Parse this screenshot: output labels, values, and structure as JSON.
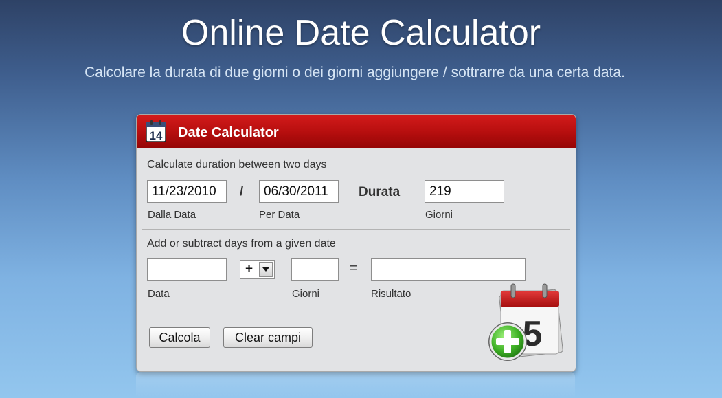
{
  "page": {
    "title": "Online Date Calculator",
    "subtitle": "Calcolare la durata di due giorni o dei giorni aggiungere / sottrarre da una certa data."
  },
  "panel": {
    "title": "Date Calculator",
    "header_icon": "calendar-icon",
    "header_icon_day": "14",
    "accent_color": "#b80f0f"
  },
  "duration": {
    "heading": "Calculate duration between two days",
    "from_value": "11/23/2010",
    "from_label": "Dalla Data",
    "separator": "/",
    "to_value": "06/30/2011",
    "to_label": "Per Data",
    "result_label": "Durata",
    "days_value": "219",
    "days_label": "Giorni"
  },
  "add_subtract": {
    "heading": "Add or subtract days from a given date",
    "date_value": "",
    "date_label": "Data",
    "operator": "+",
    "days_value": "",
    "days_label": "Giorni",
    "equals": "=",
    "result_value": "",
    "result_label": "Risultato"
  },
  "buttons": {
    "calculate": "Calcola",
    "clear": "Clear campi"
  },
  "decoration": {
    "calendar_icon": "calendar-add-icon",
    "calendar_day": "5"
  }
}
